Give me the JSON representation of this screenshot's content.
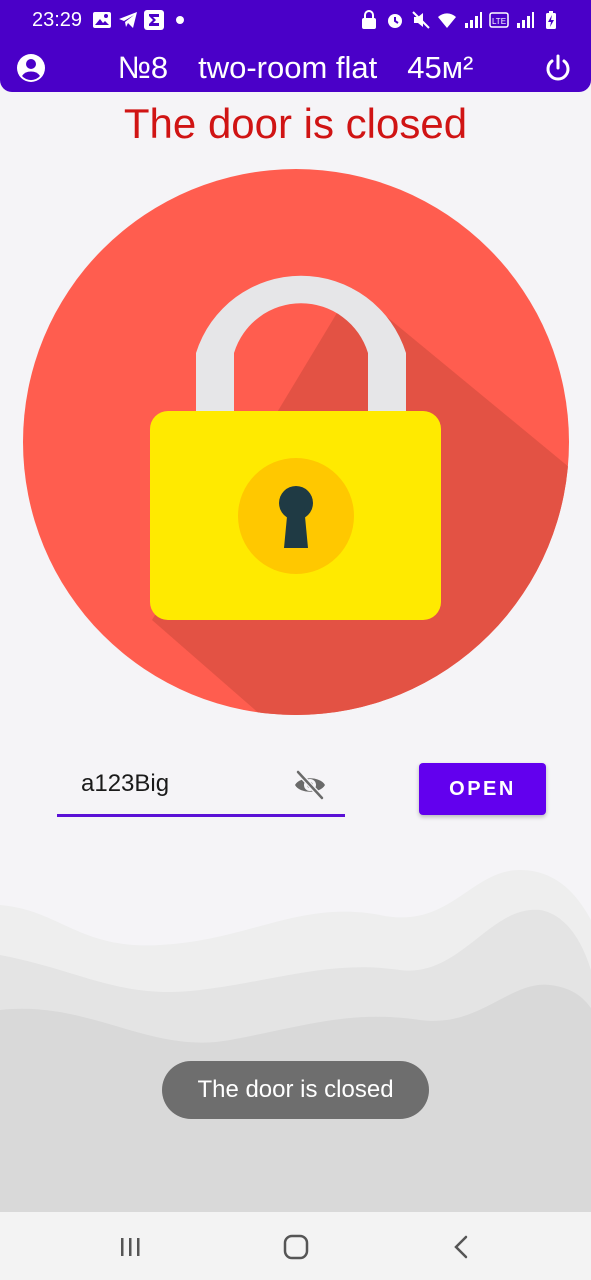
{
  "status_bar": {
    "time": "23:29",
    "left_icons": [
      "gallery-icon",
      "telegram-icon",
      "sigma-icon",
      "dot-icon"
    ],
    "right_icons": [
      "lock-badge-icon",
      "alarm-icon",
      "mute-icon",
      "wifi-icon",
      "signal-icon",
      "volte-icon",
      "signal-icon",
      "battery-charging-icon"
    ]
  },
  "app_bar": {
    "flat_number": "№8",
    "flat_type": "two-room flat",
    "flat_area": "45м²",
    "left_icon": "account-icon",
    "right_icon": "power-icon",
    "background": "#4a00c8"
  },
  "door_status": {
    "text": "The door is closed",
    "color": "#d01414"
  },
  "lock": {
    "icon": "padlock-icon",
    "circle_color": "#ff5d4f",
    "body_color": "#ffea00"
  },
  "password": {
    "value": "a123Big",
    "visibility_icon": "eye-off-icon"
  },
  "open_button": {
    "label": "OPEN",
    "color": "#6200ee"
  },
  "toast": {
    "text": "The door is closed"
  },
  "nav_bar": {
    "items": [
      "recents-icon",
      "home-icon",
      "back-icon"
    ]
  }
}
